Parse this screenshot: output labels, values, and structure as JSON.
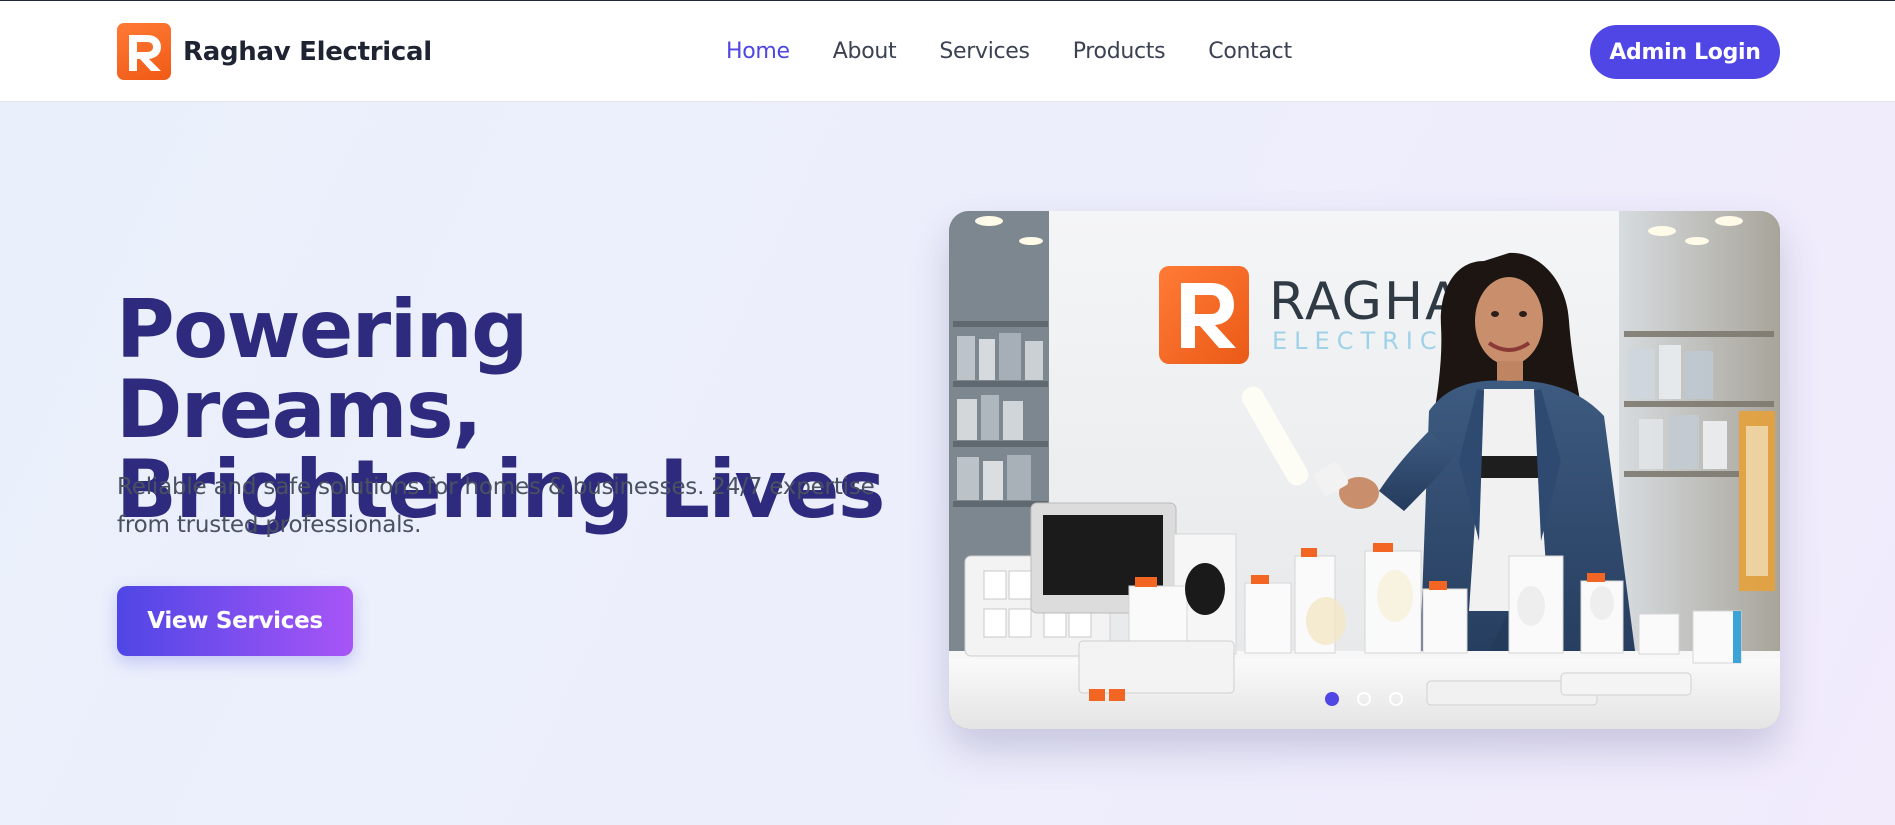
{
  "colors": {
    "accent": "#4f46e5",
    "gradient_end": "#a855f7",
    "heading": "#2e2a7e",
    "logo_orange": "#f26522"
  },
  "brand": {
    "name": "Raghav Electrical",
    "logo_icon": "r-logo-icon"
  },
  "nav": {
    "items": [
      {
        "label": "Home",
        "active": true
      },
      {
        "label": "About",
        "active": false
      },
      {
        "label": "Services",
        "active": false
      },
      {
        "label": "Products",
        "active": false
      },
      {
        "label": "Contact",
        "active": false
      }
    ]
  },
  "header": {
    "admin_label": "Admin Login"
  },
  "hero": {
    "title_line1": "Powering Dreams,",
    "title_line2": "Brightening Lives",
    "subtitle": "Reliable and safe solutions for homes & businesses. 24/7 expertise from trusted professionals.",
    "cta_label": "View Services"
  },
  "carousel": {
    "slide_count": 3,
    "active_index": 0,
    "sign_line1": "RAGHAV",
    "sign_line2": "ELECTRICAL"
  }
}
